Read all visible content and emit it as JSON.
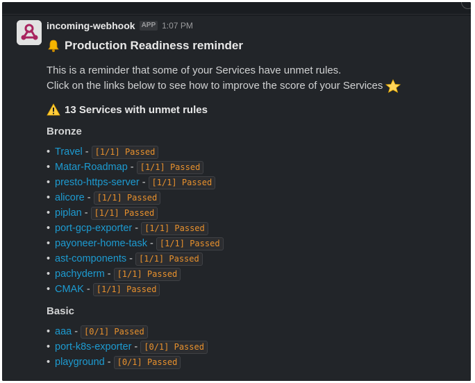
{
  "message": {
    "sender": "incoming-webhook",
    "app_badge": "APP",
    "timestamp": "1:07 PM",
    "title_icon": "bell-icon",
    "title": "Production Readiness reminder",
    "intro_line1": "This is a reminder that some of your Services have unmet rules.",
    "intro_line2": "Click on the links below to see how to improve the score of your Services",
    "star_icon": "star-icon",
    "warning_icon": "warning-icon",
    "warning_text": "13 Services with unmet rules",
    "sections": [
      {
        "name": "Bronze",
        "items": [
          {
            "service": "Travel",
            "status": "[1/1] Passed"
          },
          {
            "service": "Matar-Roadmap",
            "status": "[1/1] Passed"
          },
          {
            "service": "presto-https-server",
            "status": "[1/1] Passed"
          },
          {
            "service": "alicore",
            "status": "[1/1] Passed"
          },
          {
            "service": "piplan",
            "status": "[1/1] Passed"
          },
          {
            "service": "port-gcp-exporter",
            "status": "[1/1] Passed"
          },
          {
            "service": "payoneer-home-task",
            "status": "[1/1] Passed"
          },
          {
            "service": "ast-components",
            "status": "[1/1] Passed"
          },
          {
            "service": "pachyderm",
            "status": "[1/1] Passed"
          },
          {
            "service": "CMAK",
            "status": "[1/1] Passed"
          }
        ]
      },
      {
        "name": "Basic",
        "items": [
          {
            "service": "aaa",
            "status": "[0/1] Passed"
          },
          {
            "service": "port-k8s-exporter",
            "status": "[0/1] Passed"
          },
          {
            "service": "playground",
            "status": "[0/1] Passed"
          }
        ]
      }
    ]
  },
  "colors": {
    "background": "#222529",
    "link": "#1d9bd1",
    "code_text": "#e8912d",
    "avatar_brand": "#a8245f"
  }
}
